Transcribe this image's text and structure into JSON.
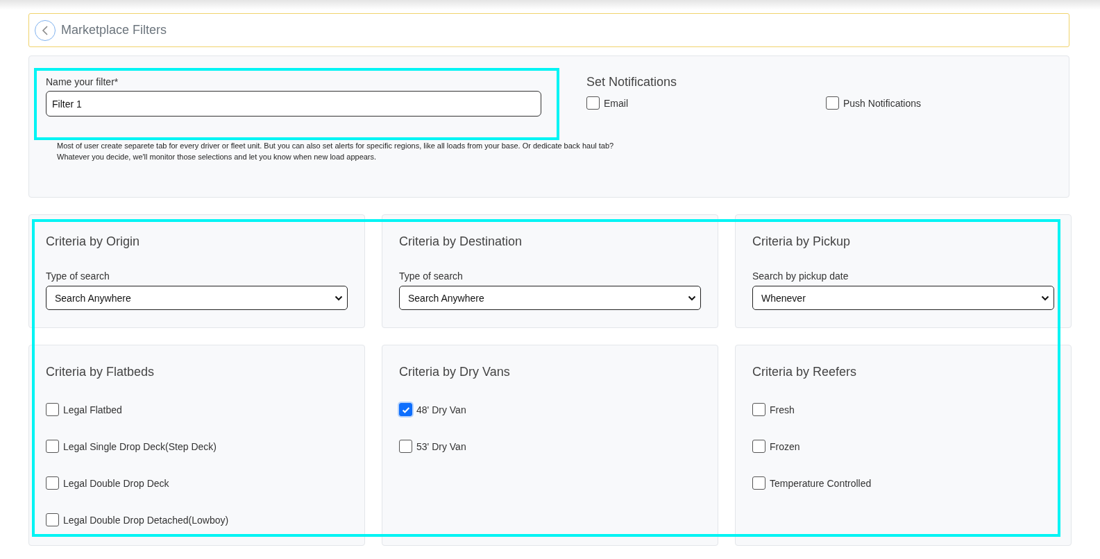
{
  "header": {
    "title": "Marketplace Filters"
  },
  "filter_name": {
    "label": "Name your filter*",
    "value": "Filter 1"
  },
  "help_text": [
    "Most of user create separete tab for every driver or fleet unit. But you can also set alerts for specific regions, like all loads from your base. Or dedicate back haul tab?",
    "Whatever you decide, we'll monitor those selections and let you know when new load appears."
  ],
  "notifications": {
    "title": "Set Notifications",
    "options": [
      {
        "label": "Email",
        "checked": false
      },
      {
        "label": "Push Notifications",
        "checked": false
      }
    ]
  },
  "cards": [
    {
      "kind": "select",
      "title": "Criteria by Origin",
      "label": "Type of search",
      "value": "Search Anywhere"
    },
    {
      "kind": "select",
      "title": "Criteria by Destination",
      "label": "Type of search",
      "value": "Search Anywhere"
    },
    {
      "kind": "select",
      "title": "Criteria by Pickup",
      "label": "Search by pickup date",
      "value": "Whenever"
    },
    {
      "kind": "checklist",
      "title": "Criteria by Flatbeds",
      "options": [
        {
          "label": "Legal Flatbed",
          "checked": false
        },
        {
          "label": "Legal Single Drop Deck(Step Deck)",
          "checked": false
        },
        {
          "label": "Legal Double Drop Deck",
          "checked": false
        },
        {
          "label": "Legal Double Drop Detached(Lowboy)",
          "checked": false
        }
      ]
    },
    {
      "kind": "checklist",
      "title": "Criteria by Dry Vans",
      "options": [
        {
          "label": "48' Dry Van",
          "checked": true
        },
        {
          "label": "53' Dry Van",
          "checked": false
        }
      ]
    },
    {
      "kind": "checklist",
      "title": "Criteria by Reefers",
      "options": [
        {
          "label": "Fresh",
          "checked": false
        },
        {
          "label": "Frozen",
          "checked": false
        },
        {
          "label": "Temperature Controlled",
          "checked": false
        }
      ]
    }
  ]
}
